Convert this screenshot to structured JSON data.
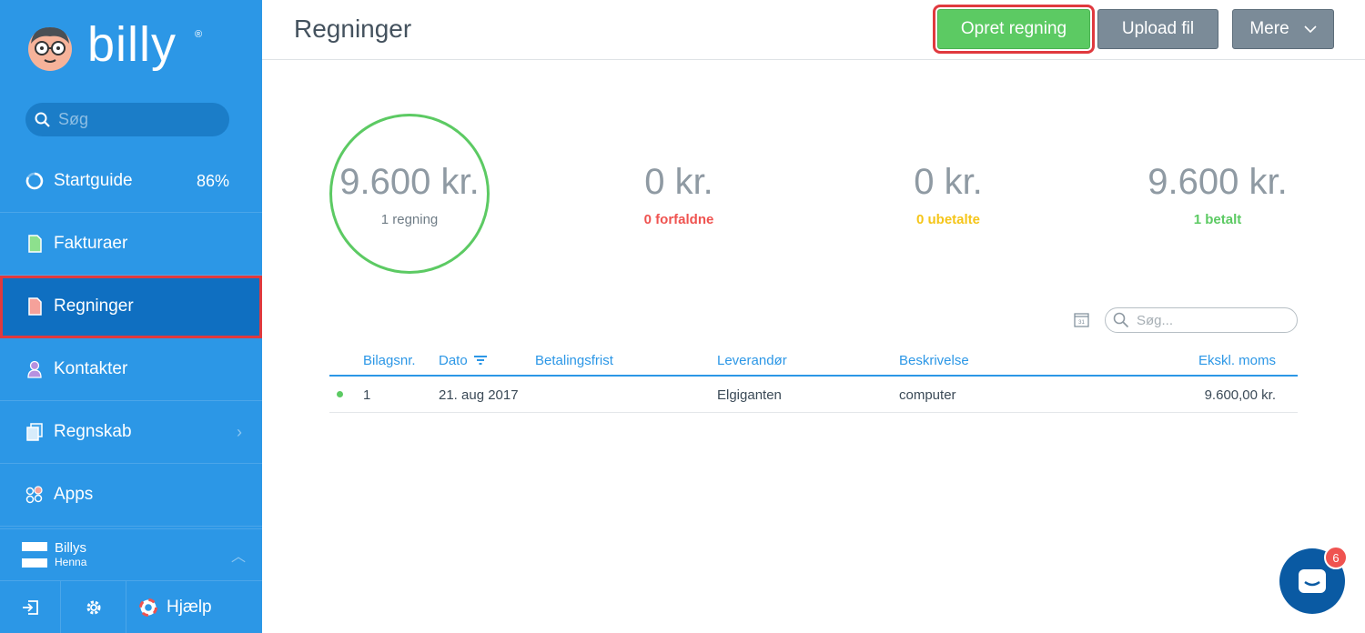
{
  "app": {
    "logo_text": "billy",
    "logo_reg": "®"
  },
  "sidebar": {
    "search_placeholder": "Søg",
    "items": [
      {
        "label": "Startguide",
        "badge": "86%",
        "icon": "progress-ring-icon"
      },
      {
        "label": "Fakturaer",
        "icon": "invoice-doc-icon"
      },
      {
        "label": "Regninger",
        "icon": "bill-doc-icon",
        "active": true
      },
      {
        "label": "Kontakter",
        "icon": "person-icon"
      },
      {
        "label": "Regnskab",
        "icon": "ledger-icon"
      },
      {
        "label": "Apps",
        "icon": "apps-icon"
      }
    ],
    "organization": {
      "name": "Billys",
      "sub": "Henna"
    },
    "help_label": "Hjælp"
  },
  "header": {
    "title": "Regninger",
    "create_label": "Opret regning",
    "upload_label": "Upload fil",
    "more_label": "Mere"
  },
  "stats": [
    {
      "amount": "9.600 kr.",
      "label": "1 regning",
      "color": "#8f9aa3"
    },
    {
      "amount": "0 kr.",
      "label": "0 forfaldne",
      "color": "#ef5350"
    },
    {
      "amount": "0 kr.",
      "label": "0 ubetalte",
      "color": "#f5c518"
    },
    {
      "amount": "9.600 kr.",
      "label": "1 betalt",
      "color": "#5cca63"
    }
  ],
  "table": {
    "search_placeholder": "Søg...",
    "calendar_day": "31",
    "columns": [
      "Bilagsnr.",
      "Dato",
      "Betalingsfrist",
      "Leverandør",
      "Beskrivelse",
      "Ekskl. moms"
    ],
    "rows": [
      {
        "bilagsnr": "1",
        "dato": "21. aug 2017",
        "betalingsfrist": "",
        "leverandor": "Elgiganten",
        "beskrivelse": "computer",
        "ekskl_moms": "9.600,00 kr."
      }
    ]
  },
  "chat": {
    "badge_count": "6"
  },
  "colors": {
    "sidebar_bg": "#2c97e6",
    "sidebar_active": "#0f6fc1",
    "create_button": "#5cca63",
    "secondary_button": "#7b8b98",
    "accent": "#2c97e6"
  }
}
